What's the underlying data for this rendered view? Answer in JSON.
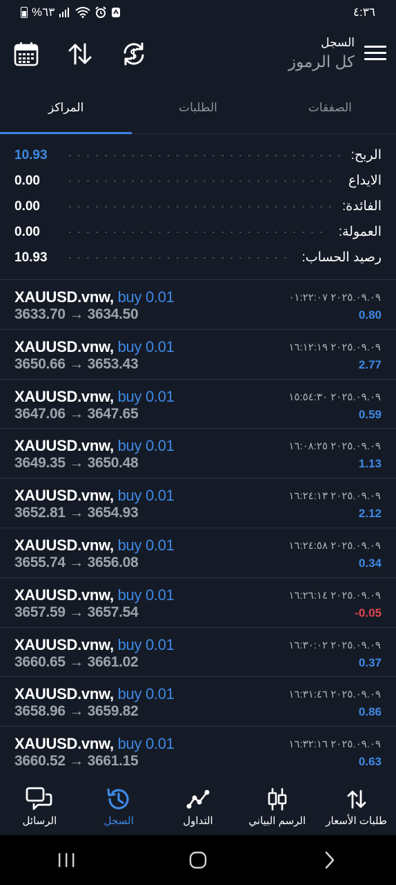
{
  "status": {
    "battery": "%٦٣",
    "time": "٤:٣٦"
  },
  "header": {
    "title": "السجل",
    "subtitle": "كل الرموز"
  },
  "tabs": [
    {
      "label": "الصفقات",
      "active": false
    },
    {
      "label": "الطلبات",
      "active": false
    },
    {
      "label": "المراكز",
      "active": true
    }
  ],
  "summary": [
    {
      "label": "الربح:",
      "value": "10.93"
    },
    {
      "label": "الايداع",
      "value": "0.00"
    },
    {
      "label": "الفائدة:",
      "value": "0.00"
    },
    {
      "label": "العمولة:",
      "value": "0.00"
    },
    {
      "label": "رصيد الحساب:",
      "value": "10.93"
    }
  ],
  "trades": [
    {
      "symbol": "XAUUSD.vnw,",
      "side": "buy 0.01",
      "open": "3633.70",
      "close": "3634.50",
      "datetime": "٢٠٢٥.٠٩.٠٩ ٠١:٢٢:٠٧",
      "profit": "0.80"
    },
    {
      "symbol": "XAUUSD.vnw,",
      "side": "buy 0.01",
      "open": "3650.66",
      "close": "3653.43",
      "datetime": "٢٠٢٥.٠٩.٠٩ ١٦:١٢:١٩",
      "profit": "2.77"
    },
    {
      "symbol": "XAUUSD.vnw,",
      "side": "buy 0.01",
      "open": "3647.06",
      "close": "3647.65",
      "datetime": "٢٠٢٥.٠٩.٠٩ ١٥:٥٤:٣٠",
      "profit": "0.59"
    },
    {
      "symbol": "XAUUSD.vnw,",
      "side": "buy 0.01",
      "open": "3649.35",
      "close": "3650.48",
      "datetime": "٢٠٢٥.٠٩.٠٩ ١٦:٠٨:٢٥",
      "profit": "1.13"
    },
    {
      "symbol": "XAUUSD.vnw,",
      "side": "buy 0.01",
      "open": "3652.81",
      "close": "3654.93",
      "datetime": "٢٠٢٥.٠٩.٠٩ ١٦:٢٤:١٣",
      "profit": "2.12"
    },
    {
      "symbol": "XAUUSD.vnw,",
      "side": "buy 0.01",
      "open": "3655.74",
      "close": "3656.08",
      "datetime": "٢٠٢٥.٠٩.٠٩ ١٦:٢٤:٥٨",
      "profit": "0.34"
    },
    {
      "symbol": "XAUUSD.vnw,",
      "side": "buy 0.01",
      "open": "3657.59",
      "close": "3657.54",
      "datetime": "٢٠٢٥.٠٩.٠٩ ١٦:٢٦:١٤",
      "profit": "-0.05"
    },
    {
      "symbol": "XAUUSD.vnw,",
      "side": "buy 0.01",
      "open": "3660.65",
      "close": "3661.02",
      "datetime": "٢٠٢٥.٠٩.٠٩ ١٦:٣٠:٠٢",
      "profit": "0.37"
    },
    {
      "symbol": "XAUUSD.vnw,",
      "side": "buy 0.01",
      "open": "3658.96",
      "close": "3659.82",
      "datetime": "٢٠٢٥.٠٩.٠٩ ١٦:٣١:٤٦",
      "profit": "0.86"
    },
    {
      "symbol": "XAUUSD.vnw,",
      "side": "buy 0.01",
      "open": "3660.52",
      "close": "3661.15",
      "datetime": "٢٠٢٥.٠٩.٠٩ ١٦:٣٢:١٦",
      "profit": "0.63"
    }
  ],
  "bottom_nav": [
    {
      "label": "الرسائل",
      "icon": "chat-icon",
      "active": false
    },
    {
      "label": "السجل",
      "icon": "history-icon",
      "active": true
    },
    {
      "label": "التداول",
      "icon": "trade-icon",
      "active": false
    },
    {
      "label": "الرسم البياني",
      "icon": "chart-icon",
      "active": false
    },
    {
      "label": "طلبات الأسعار",
      "icon": "quotes-icon",
      "active": false
    }
  ],
  "colors": {
    "background": "#151b26",
    "accent": "#3e89e6",
    "negative": "#e0464e"
  }
}
